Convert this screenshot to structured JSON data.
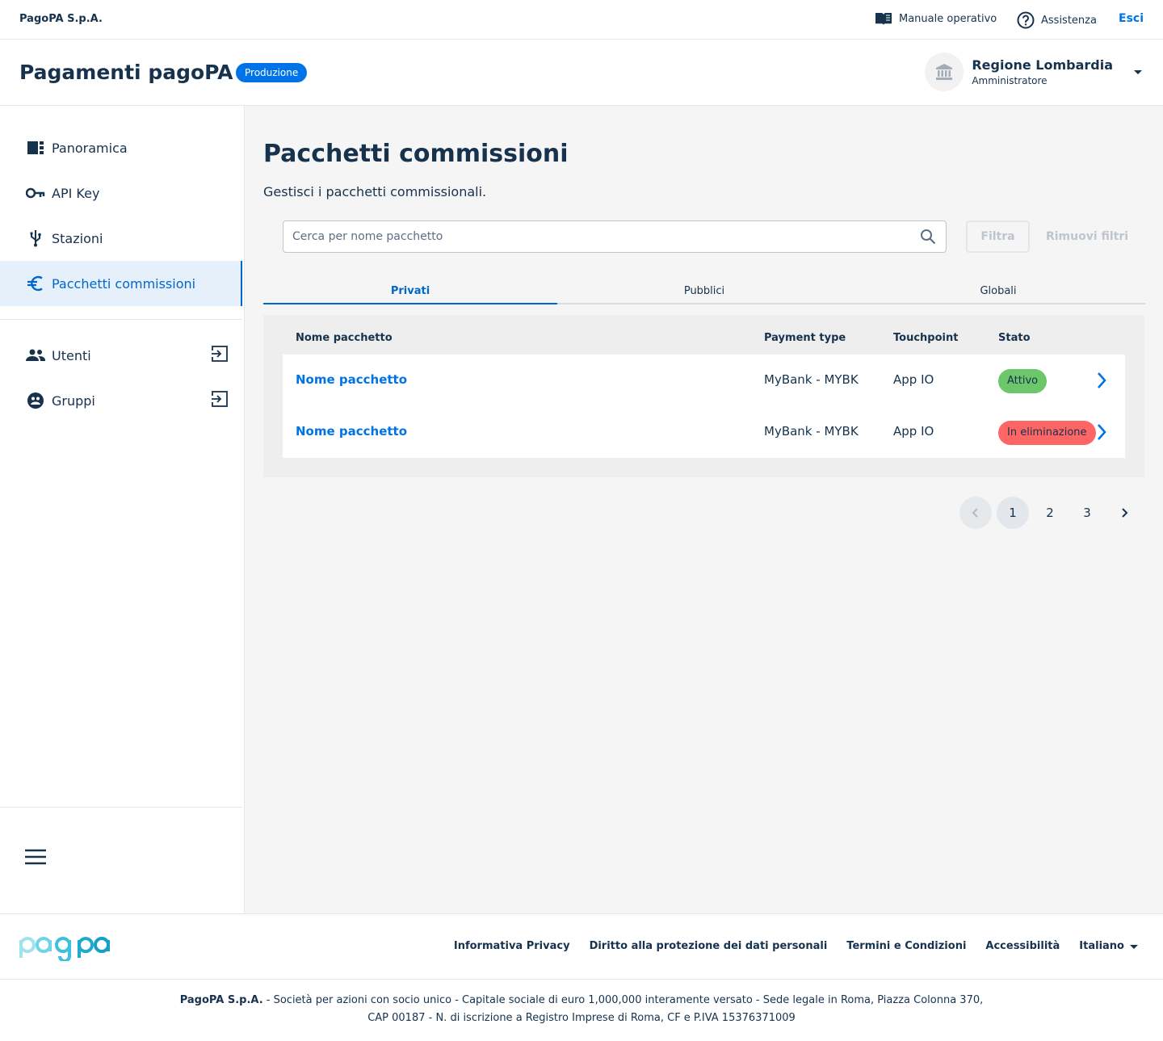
{
  "topbar": {
    "brand": "PagoPA S.p.A.",
    "manual": "Manuale operativo",
    "help": "Assistenza",
    "logout": "Esci"
  },
  "header": {
    "product": "Pagamenti pagoPA",
    "environment": "Produzione",
    "party_name": "Regione Lombardia",
    "party_role": "Amministratore"
  },
  "sidebar": {
    "items": [
      {
        "label": "Panoramica",
        "icon": "dashboard-icon"
      },
      {
        "label": "API Key",
        "icon": "key-icon"
      },
      {
        "label": "Stazioni",
        "icon": "usb-icon"
      },
      {
        "label": "Pacchetti commissioni",
        "icon": "euro-icon",
        "active": true
      },
      {
        "label": "Utenti",
        "icon": "people-icon"
      },
      {
        "label": "Gruppi",
        "icon": "group-icon"
      }
    ]
  },
  "main": {
    "title": "Pacchetti commissioni",
    "subtitle": "Gestisci i pacchetti commissionali.",
    "search_placeholder": "Cerca per nome pacchetto",
    "filter_label": "Filtra",
    "clear_label": "Rimuovi filtri",
    "tabs": [
      "Privati",
      "Pubblici",
      "Globali"
    ],
    "columns": [
      "Nome pacchetto",
      "Payment type",
      "Touchpoint",
      "Stato"
    ],
    "rows": [
      {
        "name": "Nome pacchetto",
        "payment_type": "MyBank - MYBK",
        "touchpoint": "App IO",
        "status": "Attivo"
      },
      {
        "name": "Nome pacchetto",
        "payment_type": "MyBank - MYBK",
        "touchpoint": "App IO",
        "status": "In eliminazione"
      }
    ],
    "pages": [
      "1",
      "2",
      "3"
    ]
  },
  "footer": {
    "links": [
      "Informativa Privacy",
      "Diritto alla protezione dei dati personali",
      "Termini e Condizioni",
      "Accessibilità"
    ],
    "language": "Italiano",
    "legal_company": "PagoPA S.p.A.",
    "legal_line1": " - Società per azioni con socio unico - Capitale sociale di euro 1,000,000 interamente versato - Sede legale in Roma, Piazza Colonna 370,",
    "legal_line2": "CAP 00187 - N. di iscrizione a Registro Imprese di Roma, CF e P.IVA 15376371009"
  },
  "colors": {
    "primary": "#0073E6",
    "text": "#17324D",
    "success": "#6CC66A",
    "error": "#FE6666"
  }
}
